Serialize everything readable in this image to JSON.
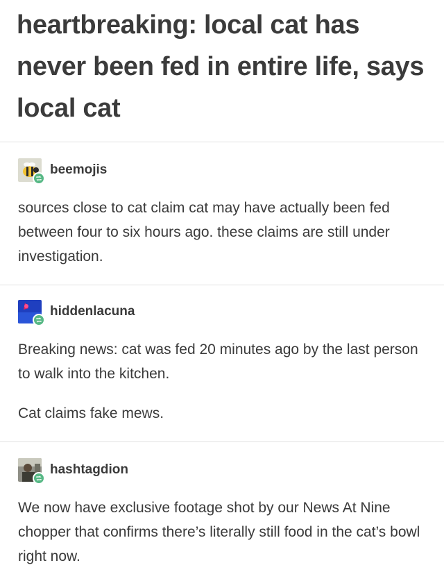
{
  "post": {
    "title": "heartbreaking: local cat has never been fed in entire life, says local cat"
  },
  "reblogs": [
    {
      "username": "beemojis",
      "avatar_icon": "bee-avatar-icon",
      "paragraphs": [
        "sources close to cat claim cat may have actually been fed between four to six hours ago. these claims are still under investigation."
      ]
    },
    {
      "username": "hiddenlacuna",
      "avatar_icon": "blue-abstract-avatar-icon",
      "paragraphs": [
        "Breaking news: cat was fed 20 minutes ago by the last person to walk into the kitchen.",
        "Cat claims fake mews."
      ]
    },
    {
      "username": "hashtagdion",
      "avatar_icon": "photo-avatar-icon",
      "paragraphs": [
        "We now have exclusive footage shot by our News At Nine chopper that confirms there’s literally still food in the cat’s bowl right now."
      ]
    }
  ],
  "colors": {
    "reblog_badge": "#57b885",
    "text": "#3a3a3a",
    "divider": "#e2e2e2"
  }
}
